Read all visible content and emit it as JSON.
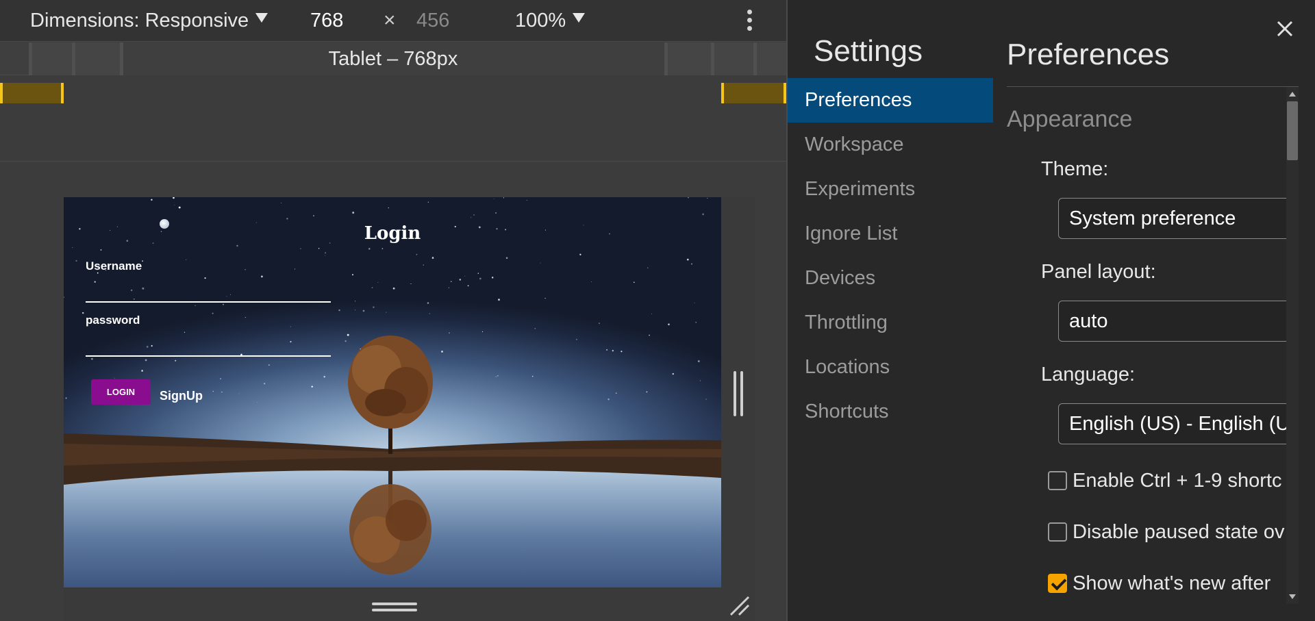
{
  "toolbar": {
    "dimensions_label": "Dimensions: Responsive",
    "width": "768",
    "times": "×",
    "height": "456",
    "zoom": "100%",
    "icons": {
      "dimensions_dropdown": "chevron-down-icon",
      "zoom_dropdown": "chevron-down-icon",
      "more": "more-vertical-icon"
    }
  },
  "media_query_bar": {
    "label": "Tablet – 768px"
  },
  "page": {
    "title": "Login",
    "username_label": "Username",
    "password_label": "password",
    "login_button": "LOGIN",
    "signup_link": "SignUp",
    "accent_color": "#8a0d8f"
  },
  "settings": {
    "title": "Settings",
    "nav": [
      {
        "label": "Preferences",
        "active": true
      },
      {
        "label": "Workspace",
        "active": false
      },
      {
        "label": "Experiments",
        "active": false
      },
      {
        "label": "Ignore List",
        "active": false
      },
      {
        "label": "Devices",
        "active": false
      },
      {
        "label": "Throttling",
        "active": false
      },
      {
        "label": "Locations",
        "active": false
      },
      {
        "label": "Shortcuts",
        "active": false
      }
    ],
    "active_color": "#044a7a",
    "close_icon": "close-icon"
  },
  "preferences": {
    "title": "Preferences",
    "section": "Appearance",
    "theme_label": "Theme:",
    "theme_value": "System preference",
    "panel_layout_label": "Panel layout:",
    "panel_layout_value": "auto",
    "language_label": "Language:",
    "language_value": "English (US) - English (U",
    "checkboxes": [
      {
        "label": "Enable Ctrl + 1-9 shortc",
        "checked": false
      },
      {
        "label": "Disable paused state ov",
        "checked": false
      },
      {
        "label": "Show what's new after",
        "checked": true
      }
    ],
    "checkbox_checked_color": "#f6a300"
  }
}
